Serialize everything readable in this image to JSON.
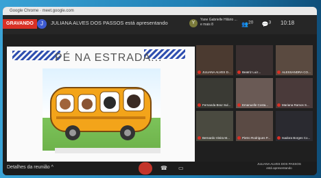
{
  "url_bar": "Google Chrome · meet.google.com",
  "topbar": {
    "recording": "GRAVANDO",
    "presenter_initial": "J",
    "presenting_text": "JULIANA ALVES DOS PASSOS está apresentando",
    "people_initial": "Y",
    "people_text_1": "Yane Gabrielle Hilário ...",
    "people_text_2": "e mais 8",
    "participants_count": "20",
    "chat_count": "3",
    "time": "10:18"
  },
  "slide": {
    "title": "PÉ NA ESTRADA..."
  },
  "participants": [
    {
      "label": "JULIANA ALVES D..."
    },
    {
      "label": "Beatriz Luiz..."
    },
    {
      "label": "ALESSANDRA CO..."
    },
    {
      "label": "Fernanda Braz Sul..."
    },
    {
      "label": "Emanuelle Costa..."
    },
    {
      "label": "Mariana Ramos S..."
    },
    {
      "label": "Bernardo Vieira M..."
    },
    {
      "label": "Pietro Rodrigues P..."
    },
    {
      "label": "Isadora Borges Co..."
    }
  ],
  "bottombar": {
    "details": "Detalhes da reunião",
    "presenting_name": "JULIANA ALVES DOS PASSOS",
    "presenting_sub": "está apresentando"
  },
  "colors": {
    "record_red": "#d93025",
    "accent_blue": "#3d5bd1"
  }
}
